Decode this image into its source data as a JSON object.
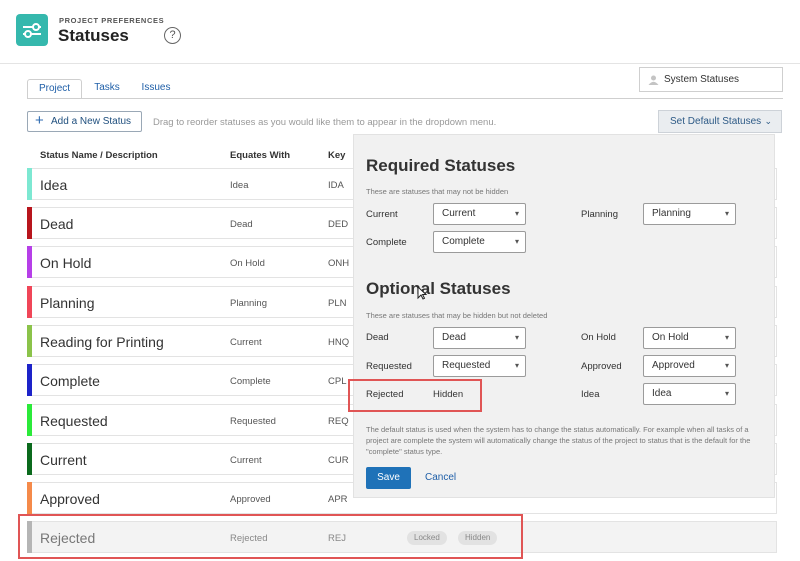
{
  "header": {
    "kicker": "PROJECT PREFERENCES",
    "title": "Statuses",
    "help_icon": "question-circle-icon",
    "help_glyph": "?"
  },
  "tabs": [
    {
      "label": "Project",
      "active": true
    },
    {
      "label": "Tasks",
      "active": false
    },
    {
      "label": "Issues",
      "active": false
    }
  ],
  "system_statuses": {
    "label": "System Statuses",
    "icon": "user-icon"
  },
  "toolbar": {
    "add_label": "Add a New Status",
    "add_icon": "plus-icon",
    "hint": "Drag to reorder statuses as you would like them to appear in the dropdown menu.",
    "default_label": "Set Default Statuses",
    "default_icon": "chevron-down-icon"
  },
  "columns": {
    "name": "Status Name / Description",
    "equates": "Equates With",
    "key": "Key"
  },
  "rows": [
    {
      "name": "Idea",
      "equates": "Idea",
      "key": "IDA",
      "color": "#7de8d2"
    },
    {
      "name": "Dead",
      "equates": "Dead",
      "key": "DED",
      "color": "#b8151d"
    },
    {
      "name": "On Hold",
      "equates": "On Hold",
      "key": "ONH",
      "color": "#b63fe8"
    },
    {
      "name": "Planning",
      "equates": "Planning",
      "key": "PLN",
      "color": "#f04658"
    },
    {
      "name": "Reading for Printing",
      "equates": "Current",
      "key": "HNQ",
      "color": "#8bc34a"
    },
    {
      "name": "Complete",
      "equates": "Complete",
      "key": "CPL",
      "color": "#1d23c9"
    },
    {
      "name": "Requested",
      "equates": "Requested",
      "key": "REQ",
      "color": "#2bea3a"
    },
    {
      "name": "Current",
      "equates": "Current",
      "key": "CUR",
      "color": "#0b6a1d"
    },
    {
      "name": "Approved",
      "equates": "Approved",
      "key": "APR",
      "color": "#f58a4a"
    },
    {
      "name": "Rejected",
      "equates": "Rejected",
      "key": "REJ",
      "color": "#b5b5b5",
      "badges": [
        "Locked",
        "Hidden"
      ]
    }
  ],
  "modal": {
    "required_title": "Required Statuses",
    "required_sub": "These are statuses that may not be hidden",
    "optional_title": "Optional Statuses",
    "optional_sub": "These are statuses that may be hidden but not deleted",
    "fields": {
      "current": {
        "label": "Current",
        "value": "Current"
      },
      "planning": {
        "label": "Planning",
        "value": "Planning"
      },
      "complete": {
        "label": "Complete",
        "value": "Complete"
      },
      "dead": {
        "label": "Dead",
        "value": "Dead"
      },
      "on_hold": {
        "label": "On Hold",
        "value": "On Hold"
      },
      "requested": {
        "label": "Requested",
        "value": "Requested"
      },
      "approved": {
        "label": "Approved",
        "value": "Approved"
      },
      "rejected": {
        "label": "Rejected",
        "value": "Hidden"
      },
      "idea": {
        "label": "Idea",
        "value": "Idea"
      }
    },
    "note": "The default status is used when the system has to change the status automatically. For example when all tasks of a project are complete the system will automatically change the status of the project to status that is the default for the \"complete\" status type.",
    "save_label": "Save",
    "cancel_label": "Cancel"
  },
  "colors": {
    "accent": "#35b8ad",
    "primary_button": "#1f72b8",
    "highlight": "#e05555"
  }
}
